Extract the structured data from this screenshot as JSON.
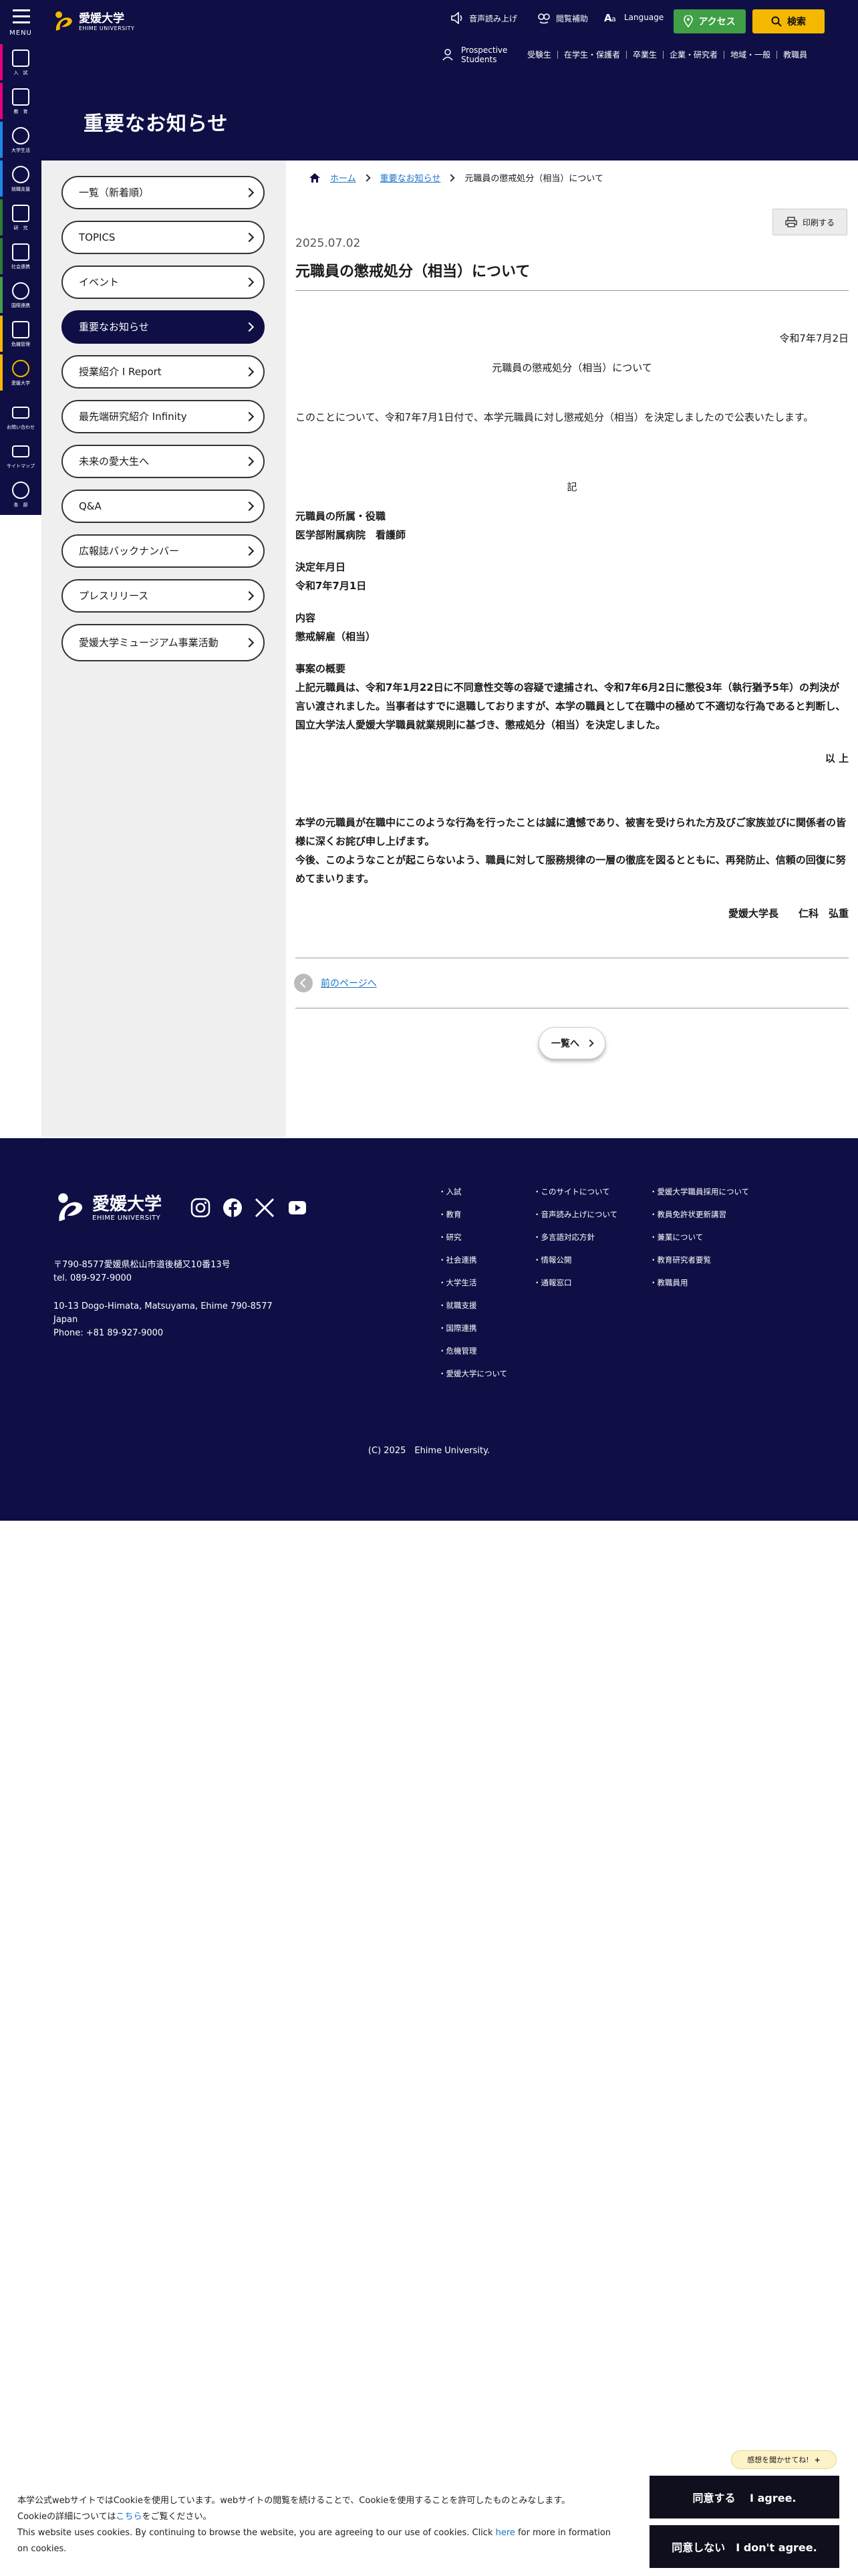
{
  "header": {
    "menu_label": "MENU",
    "logo_ja": "愛媛大学",
    "logo_en": "EHIME UNIVERSITY",
    "read_aloud": "音声読み上げ",
    "reading_aid": "閲覧補助",
    "language": "Language",
    "access": "アクセス",
    "search": "検索",
    "prospective": "Prospective Students",
    "audience": [
      "受験生",
      "在学生・保護者",
      "卒業生",
      "企業・研究者",
      "地域・一般",
      "教職員"
    ],
    "page_heading": "重要なお知らせ"
  },
  "rail": {
    "items": [
      {
        "label": "入　試",
        "icon": "book-icon",
        "stripe": "#e6007e"
      },
      {
        "label": "教　育",
        "icon": "school-icon",
        "stripe": "#e6007e"
      },
      {
        "label": "大学生活",
        "icon": "people-icon",
        "stripe": "#1e88e5"
      },
      {
        "label": "就職支援",
        "icon": "person-icon",
        "stripe": "#1e88e5"
      },
      {
        "label": "研　究",
        "icon": "microscope-icon",
        "stripe": "#2e7d32"
      },
      {
        "label": "社会連携",
        "icon": "building-icon",
        "stripe": "#2e7d32"
      },
      {
        "label": "国際連携",
        "icon": "globe-icon",
        "stripe": "#43a047"
      },
      {
        "label": "危機管理",
        "icon": "shield-icon",
        "stripe": "#f5b800"
      },
      {
        "label": "愛媛大学",
        "icon": "logo-icon",
        "stripe": "#f5b800"
      },
      {
        "label": "お問い合わせ",
        "icon": "mail-icon",
        "stripe": ""
      },
      {
        "label": "サイトマップ",
        "icon": "sitemap-icon",
        "stripe": ""
      },
      {
        "label": "各　部",
        "icon": "gear-icon",
        "stripe": ""
      }
    ]
  },
  "sidebar": {
    "items": [
      {
        "label": "一覧（新着順）",
        "active": false
      },
      {
        "label": "TOPICS",
        "active": false
      },
      {
        "label": "イベント",
        "active": false
      },
      {
        "label": "重要なお知らせ",
        "active": true
      },
      {
        "label": "授業紹介 I Report",
        "active": false
      },
      {
        "label": "最先端研究紹介 Infinity",
        "active": false
      },
      {
        "label": "未来の愛大生へ",
        "active": false
      },
      {
        "label": "Q&A",
        "active": false
      },
      {
        "label": "広報誌バックナンバー",
        "active": false
      },
      {
        "label": "プレスリリース",
        "active": false
      },
      {
        "label": "愛媛大学ミュージアム事業活動",
        "active": false
      }
    ]
  },
  "breadcrumb": {
    "home": "ホーム",
    "parent": "重要なお知らせ",
    "current": "元職員の懲戒処分（相当）について"
  },
  "post": {
    "print": "印刷する",
    "date": "2025.07.02",
    "title": "元職員の懲戒処分（相当）について",
    "doc_date": "令和7年7月2日",
    "doc_title": "元職員の懲戒処分（相当）について",
    "intro": "このことについて、令和7年7月1日付で、本学元職員に対し懲戒処分（相当）を決定しましたので公表いたします。",
    "ki": "記",
    "role_heading": "元職員の所属・役職",
    "role_value": "医学部附属病院　看護師",
    "decision_heading": "決定年月日",
    "decision_value": "令和7年7月1日",
    "content_heading": "内容",
    "content_value": "懲戒解雇（相当）",
    "summary_heading": "事案の概要",
    "summary_value": "上記元職員は、令和7年1月22日に不同意性交等の容疑で逮捕され、令和7年6月2日に懲役3年（執行猶予5年）の判決が言い渡されました。当事者はすでに退職しておりますが、本学の職員として在職中の極めて不適切な行為であると判断し、国立大学法人愛媛大学職員就業規則に基づき、懲戒処分（相当）を決定しました。",
    "ijo": "以 上",
    "closing1": "本学の元職員が在職中にこのような行為を行ったことは誠に遺憾であり、被害を受けられた方及びご家族並びに関係者の皆様に深くお詫び申し上げます。",
    "closing2": "今後、このようなことが起こらないよう、職員に対して服務規律の一層の徹底を図るとともに、再発防止、信頼の回復に努めてまいります。",
    "signature": "愛媛大学長　　仁科　弘重",
    "prev": "前のページへ",
    "list": "一覧へ"
  },
  "footer": {
    "logo_ja": "愛媛大学",
    "logo_en": "EHIME UNIVERSITY",
    "addr_ja_1": "〒790-8577愛媛県松山市道後樋又10番13号",
    "addr_ja_2": "tel. 089-927-9000",
    "addr_en_1": "10-13 Dogo-Himata, Matsuyama, Ehime 790-8577",
    "addr_en_2": "Japan",
    "addr_en_3": "Phone: +81 89-927-9000",
    "col1": [
      "・入試",
      "・教育",
      "・研究",
      "・社会連携",
      "・大学生活",
      "・就職支援",
      "・国際連携",
      "・危機管理",
      "・愛媛大学について"
    ],
    "col2": [
      "・このサイトについて",
      "・音声読み上げについて",
      "・多言語対応方針",
      "・情報公開",
      "・通報窓口"
    ],
    "col3": [
      "・愛媛大学職員採用について",
      "・教員免許状更新講習",
      "・兼業について",
      "・教育研究者要覧",
      "・教職員用"
    ],
    "copyright": "(C) 2025　Ehime University."
  },
  "cookie": {
    "line1": "本学公式webサイトではCookieを使用しています。webサイトの閲覧を続けることで、Cookieを使用することを許可したものとみなします。",
    "line2_pre": "Cookieの詳細については",
    "line2_link": "こちら",
    "line2_post": "をご覧ください。",
    "line3_pre": "This website uses cookies. By continuing to browse the website, you are agreeing to our use of cookies. Click ",
    "line3_link": "here",
    "line3_post": " for more in formation on cookies.",
    "agree": "同意する　 I agree.",
    "deny": "同意しない　I don't agree.",
    "feedback": "感想を聞かせてね!",
    "feedback_plus": "+"
  },
  "colors": {
    "navy": "#0f0f45",
    "access_green": "#3fa046",
    "search_yellow": "#f5b800",
    "link_blue": "#1a73c8"
  }
}
